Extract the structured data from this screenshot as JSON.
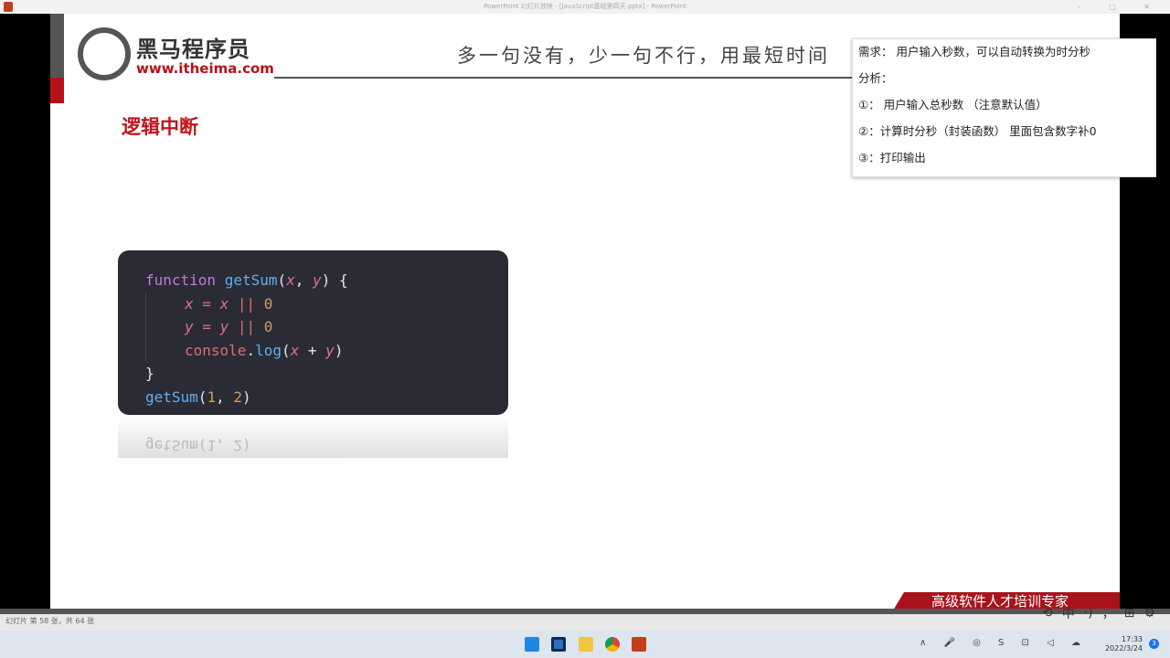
{
  "window": {
    "title": "PowerPoint 幻灯片放映 - [JavaScript基础第四天.pptx] - PowerPoint",
    "controls": "–  ▢  ✕"
  },
  "slide": {
    "logo_cn": "黑马程序员",
    "logo_en": "www.itheima.com",
    "motto": "多一句没有，少一句不行，用最短时间",
    "title": "逻辑中断",
    "code": [
      "function getSum(x, y) {",
      "x = x || 0",
      "y = y || 0",
      "console.log(x + y)",
      "}",
      "getSum(1, 2)"
    ],
    "reflection": "getSum(1, 2)",
    "banner": "高级软件人才培训专家"
  },
  "popup": {
    "lines": [
      "需求： 用户输入秒数，可以自动转换为时分秒",
      "分析：",
      "①： 用户输入总秒数 （注意默认值）",
      "②：计算时分秒（封装函数） 里面包含数字补0",
      "③：打印输出"
    ]
  },
  "status": {
    "slide_info": "幻灯片 第 58 张，共 64 张"
  },
  "ime": {
    "mode": "中",
    "items": [
      "⟲",
      "中",
      "·)",
      "，",
      "⊞",
      "⚙"
    ]
  },
  "taskbar": {
    "time": "17:33",
    "date": "2022/3/24",
    "notifications": "3",
    "tray": "∧ 🎤 ◎ S ⊡ ◁ ☁"
  }
}
